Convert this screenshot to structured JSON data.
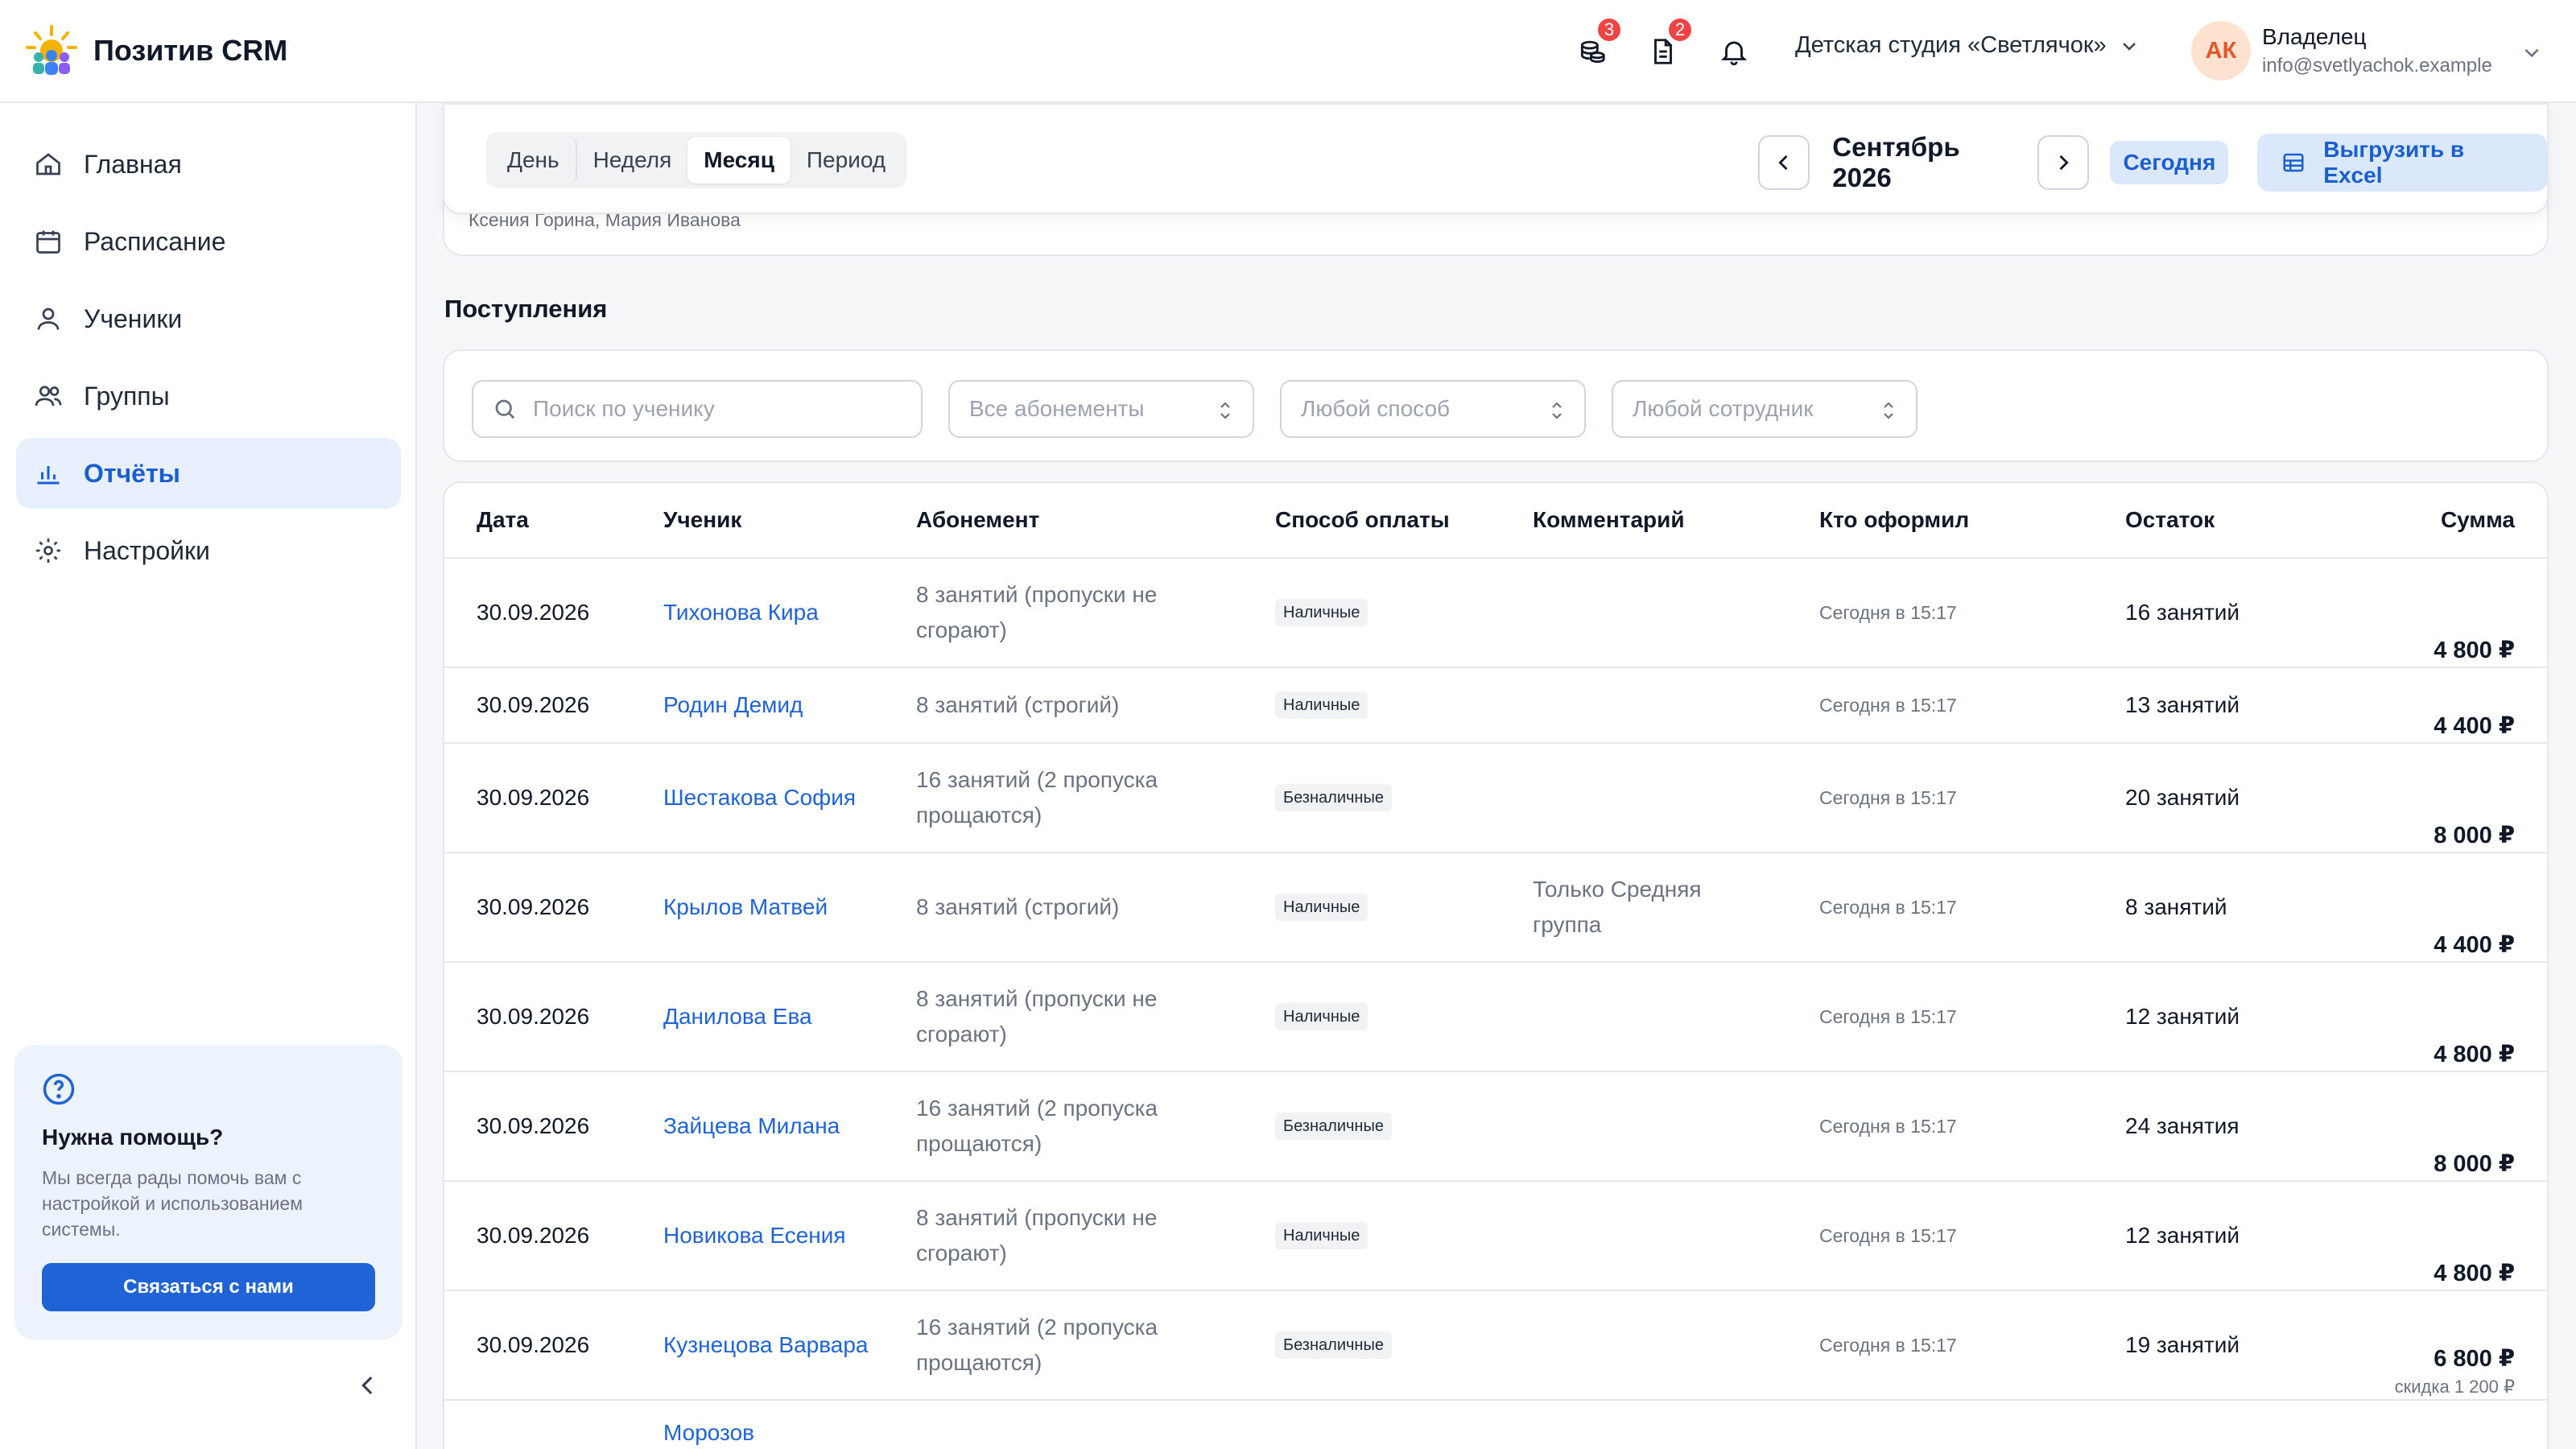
{
  "app": {
    "name": "Позитив CRM"
  },
  "header": {
    "icons": [
      {
        "name": "coins-icon",
        "badge": "3"
      },
      {
        "name": "document-icon",
        "badge": "2"
      },
      {
        "name": "bell-icon",
        "badge": ""
      }
    ],
    "studio": "Детская студия «Светлячок»",
    "user": {
      "initials": "АК",
      "name": "Владелец",
      "email": "info@svetlyachok.example"
    }
  },
  "sidebar": {
    "items": [
      {
        "label": "Главная",
        "icon": "home-icon",
        "active": false
      },
      {
        "label": "Расписание",
        "icon": "calendar-icon",
        "active": false
      },
      {
        "label": "Ученики",
        "icon": "user-icon",
        "active": false
      },
      {
        "label": "Группы",
        "icon": "users-icon",
        "active": false
      },
      {
        "label": "Отчёты",
        "icon": "chart-icon",
        "active": true
      },
      {
        "label": "Настройки",
        "icon": "gear-icon",
        "active": false
      }
    ],
    "help": {
      "title": "Нужна помощь?",
      "text": "Мы всегда рады помочь вам с настройкой и использованием системы.",
      "button": "Связаться с нами"
    }
  },
  "toolbar": {
    "segments": [
      "День",
      "Неделя",
      "Месяц",
      "Период"
    ],
    "active_segment": "Месяц",
    "period": "Сентябрь 2026",
    "today": "Сегодня",
    "export": "Выгрузить в Excel"
  },
  "behind_text": "Ксения Горина, Мария Иванова",
  "section_title": "Поступления",
  "filters": {
    "search_placeholder": "Поиск по ученику",
    "subscription": "Все абонементы",
    "method": "Любой способ",
    "employee": "Любой сотрудник"
  },
  "table": {
    "columns": [
      "Дата",
      "Ученик",
      "Абонемент",
      "Способ оплаты",
      "Комментарий",
      "Кто оформил",
      "Остаток",
      "Сумма"
    ],
    "rows": [
      {
        "date": "30.09.2026",
        "student": "Тихонова Кира",
        "subscription": "8 занятий (пропуски не сгорают)",
        "method": "Наличные",
        "comment": "",
        "who": "Сегодня в 15:17",
        "rest": "16 занятий",
        "sum": "4 800 ₽",
        "discount": ""
      },
      {
        "date": "30.09.2026",
        "student": "Родин Демид",
        "subscription": "8 занятий (строгий)",
        "method": "Наличные",
        "comment": "",
        "who": "Сегодня в 15:17",
        "rest": "13 занятий",
        "sum": "4 400 ₽",
        "discount": ""
      },
      {
        "date": "30.09.2026",
        "student": "Шестакова София",
        "subscription": "16 занятий (2 пропуска прощаются)",
        "method": "Безналичные",
        "comment": "",
        "who": "Сегодня в 15:17",
        "rest": "20 занятий",
        "sum": "8 000 ₽",
        "discount": ""
      },
      {
        "date": "30.09.2026",
        "student": "Крылов Матвей",
        "subscription": "8 занятий (строгий)",
        "method": "Наличные",
        "comment": "Только Средняя группа",
        "who": "Сегодня в 15:17",
        "rest": "8 занятий",
        "sum": "4 400 ₽",
        "discount": ""
      },
      {
        "date": "30.09.2026",
        "student": "Данилова Ева",
        "subscription": "8 занятий (пропуски не сгорают)",
        "method": "Наличные",
        "comment": "",
        "who": "Сегодня в 15:17",
        "rest": "12 занятий",
        "sum": "4 800 ₽",
        "discount": ""
      },
      {
        "date": "30.09.2026",
        "student": "Зайцева Милана",
        "subscription": "16 занятий (2 пропуска прощаются)",
        "method": "Безналичные",
        "comment": "",
        "who": "Сегодня в 15:17",
        "rest": "24 занятия",
        "sum": "8 000 ₽",
        "discount": ""
      },
      {
        "date": "30.09.2026",
        "student": "Новикова Есения",
        "subscription": "8 занятий (пропуски не сгорают)",
        "method": "Наличные",
        "comment": "",
        "who": "Сегодня в 15:17",
        "rest": "12 занятий",
        "sum": "4 800 ₽",
        "discount": ""
      },
      {
        "date": "30.09.2026",
        "student": "Кузнецова Варвара",
        "subscription": "16 занятий (2 пропуска прощаются)",
        "method": "Безналичные",
        "comment": "",
        "who": "Сегодня в 15:17",
        "rest": "19 занятий",
        "sum": "6 800 ₽",
        "discount": "скидка 1 200 ₽"
      },
      {
        "date": "",
        "student": "Морозов",
        "subscription": "",
        "method": "",
        "comment": "",
        "who": "",
        "rest": "",
        "sum": "",
        "discount": ""
      }
    ]
  },
  "colors": {
    "accent": "#1f63d6",
    "active_bg": "#e8f0fd",
    "badge": "#ef4444"
  }
}
